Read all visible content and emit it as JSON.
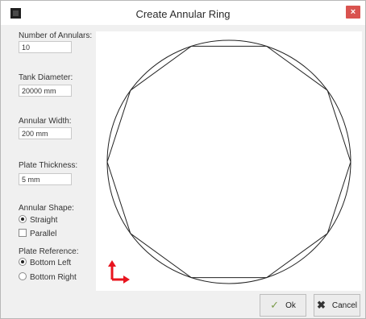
{
  "window": {
    "title": "Create Annular Ring",
    "close_glyph": "×"
  },
  "fields": {
    "num_annulars": {
      "label": "Number of Annulars:",
      "value": "10"
    },
    "tank_diameter": {
      "label": "Tank Diameter:",
      "value": "20000 mm"
    },
    "annular_width": {
      "label": "Annular Width:",
      "value": "200 mm"
    },
    "plate_thickness": {
      "label": "Plate Thickness:",
      "value": "5 mm"
    }
  },
  "annular_shape": {
    "label": "Annular Shape:",
    "options": [
      {
        "label": "Straight",
        "selected": true
      },
      {
        "label": "Parallel",
        "selected": false
      }
    ]
  },
  "plate_reference": {
    "label": "Plate Reference:",
    "options": [
      {
        "label": "Bottom Left",
        "selected": true
      },
      {
        "label": "Bottom Right",
        "selected": false
      }
    ]
  },
  "buttons": {
    "ok": "Ok",
    "cancel": "Cancel"
  },
  "preview": {
    "segments": 10,
    "axis_color": "#e8141e"
  }
}
